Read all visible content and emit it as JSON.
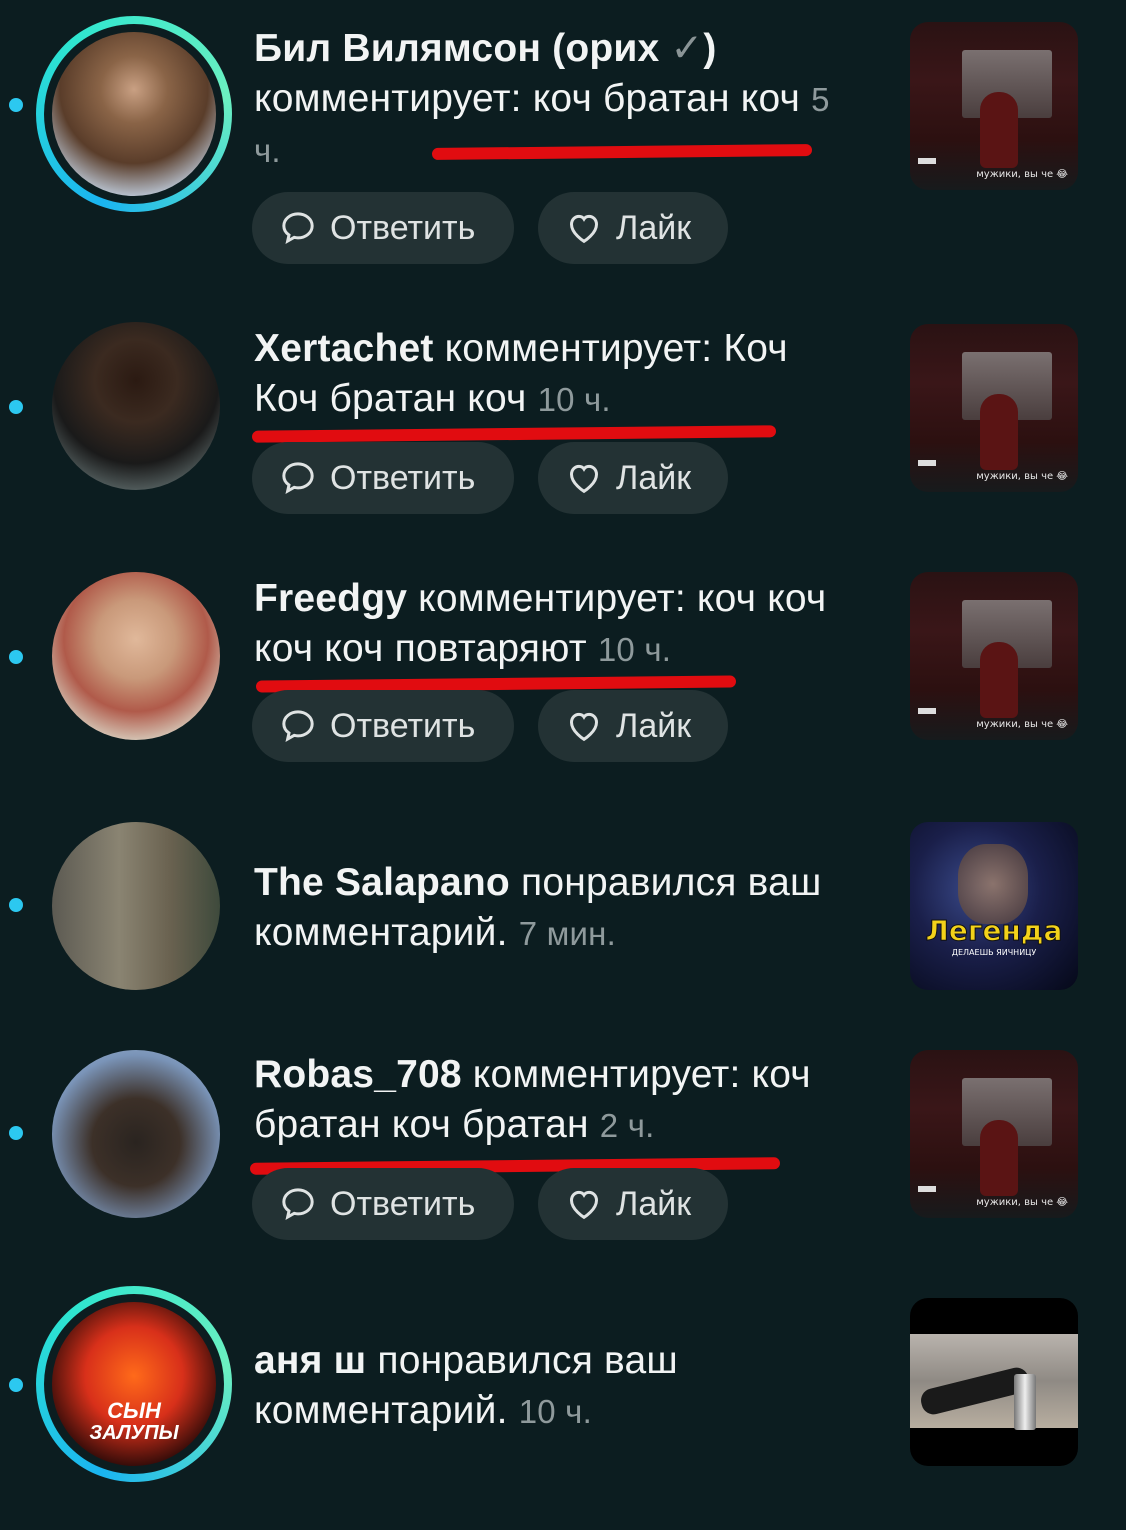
{
  "notifications": [
    {
      "name": "Бил Вилямсон (орих",
      "name_suffix": ")",
      "badge": "✓",
      "action": "комментирует: коч братан коч",
      "time": "5 ч.",
      "reply_label": "Ответить",
      "like_label": "Лайк",
      "thumbnail_caption": "мужики, вы че 😂"
    },
    {
      "name": "Xertachet",
      "action": "комментирует: Коч Коч братан коч",
      "time": "10 ч.",
      "reply_label": "Ответить",
      "like_label": "Лайк",
      "thumbnail_caption": "мужики, вы че 😂"
    },
    {
      "name": "Freedgy",
      "action": "комментирует: коч коч коч коч повтаряют",
      "time": "10 ч.",
      "reply_label": "Ответить",
      "like_label": "Лайк",
      "thumbnail_caption": "мужики, вы че 😂"
    },
    {
      "name": "The Salapano",
      "action": "понравился ваш комментарий.",
      "time": "7 мин.",
      "thumbnail_title": "Легенда",
      "thumbnail_sub": "ДЕЛАЕШЬ ЯИЧНИЦУ"
    },
    {
      "name": "Robas_708",
      "action": "комментирует: коч братан коч братан",
      "time": "2 ч.",
      "reply_label": "Ответить",
      "like_label": "Лайк",
      "thumbnail_caption": "мужики, вы че 😂"
    },
    {
      "name": "аня ш",
      "action": "понравился ваш комментарий.",
      "time": "10 ч.",
      "avatar_text_top": "СЫН",
      "avatar_text_bottom": "ЗАЛУПЫ"
    }
  ],
  "colors": {
    "background": "#0c1d20",
    "button_bg": "#233234",
    "unread_dot": "#2cc8f0",
    "underline": "#e10c10"
  }
}
